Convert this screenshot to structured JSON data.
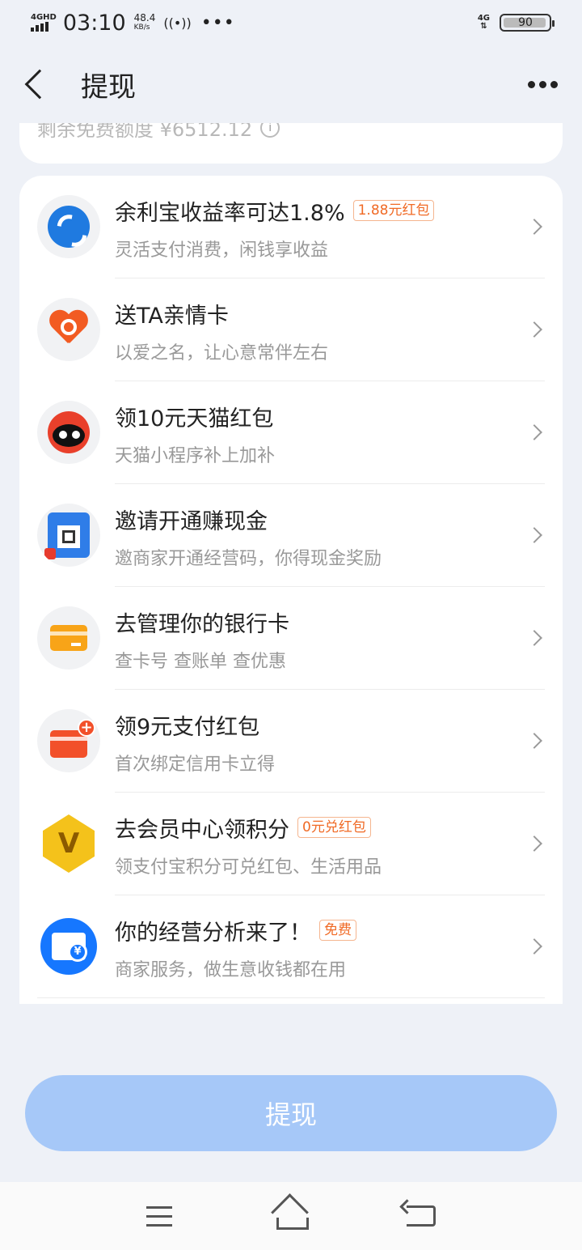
{
  "status_bar": {
    "network": "4GHD",
    "time": "03:10",
    "speed_value": "48.4",
    "speed_unit": "KB/s",
    "dots": "•••",
    "network_right": "4G",
    "battery": "90"
  },
  "header": {
    "title": "提现"
  },
  "quota": {
    "text": "剩余免费额度 ¥6512.12",
    "info_glyph": "i"
  },
  "items": [
    {
      "title": "余利宝收益率可达1.8%",
      "tag": "1.88元红包",
      "subtitle": "灵活支付消费，闲钱享收益",
      "icon": "yulibao-icon"
    },
    {
      "title": "送TA亲情卡",
      "tag": "",
      "subtitle": "以爱之名，让心意常伴左右",
      "icon": "heart-icon"
    },
    {
      "title": "领10元天猫红包",
      "tag": "",
      "subtitle": "天猫小程序补上加补",
      "icon": "tmall-cat-icon"
    },
    {
      "title": "邀请开通赚现金",
      "tag": "",
      "subtitle": "邀商家开通经营码，你得现金奖励",
      "icon": "qr-code-icon"
    },
    {
      "title": "去管理你的银行卡",
      "tag": "",
      "subtitle": "查卡号 查账单 查优惠",
      "icon": "bank-card-icon"
    },
    {
      "title": "领9元支付红包",
      "tag": "",
      "subtitle": "首次绑定信用卡立得",
      "icon": "add-card-icon"
    },
    {
      "title": "去会员中心领积分",
      "tag": "0元兑红包",
      "subtitle": "领支付宝积分可兑红包、生活用品",
      "icon": "vip-v-icon",
      "icon_text": "V"
    },
    {
      "title": "你的经营分析来了！",
      "tag": "免费",
      "subtitle": "商家服务，做生意收钱都在用",
      "icon": "shop-icon",
      "icon_text": "¥"
    }
  ],
  "withdraw_button": "提现"
}
